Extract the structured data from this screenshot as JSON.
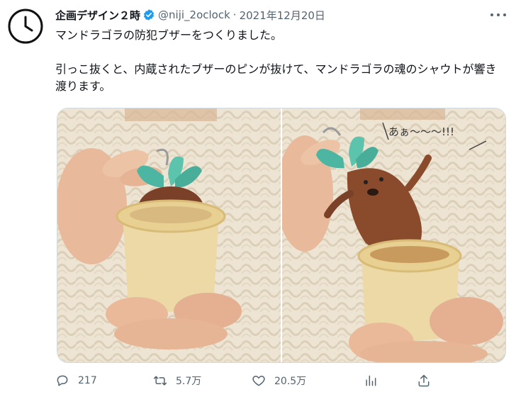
{
  "tweet": {
    "author_name": "企画デザイン２時",
    "handle": "@niji_2oclock",
    "separator": "·",
    "date": "2021年12月20日",
    "paragraph_1": "マンドラゴラの防犯ブザーをつくりました。",
    "paragraph_2": "引っこ抜くと、内蔵されたブザーのピンが抜けて、マンドラゴラの魂のシャウトが響き渡ります。",
    "images": [
      {
        "icon": "photo-mandrake-in-pot"
      },
      {
        "icon": "photo-mandrake-pulled-out",
        "caption": "あぁ〜〜〜!!!"
      }
    ],
    "actions": {
      "reply_count": "217",
      "retweet_count": "5.7万",
      "like_count": "20.5万"
    }
  },
  "colors": {
    "text": "#0f1419",
    "secondary": "#536471",
    "verified": "#1d9bf0",
    "border": "#cfd9de"
  },
  "icons": [
    "clock-icon",
    "verified-badge-icon",
    "more-icon",
    "reply-icon",
    "retweet-icon",
    "like-icon",
    "views-icon",
    "share-icon"
  ]
}
